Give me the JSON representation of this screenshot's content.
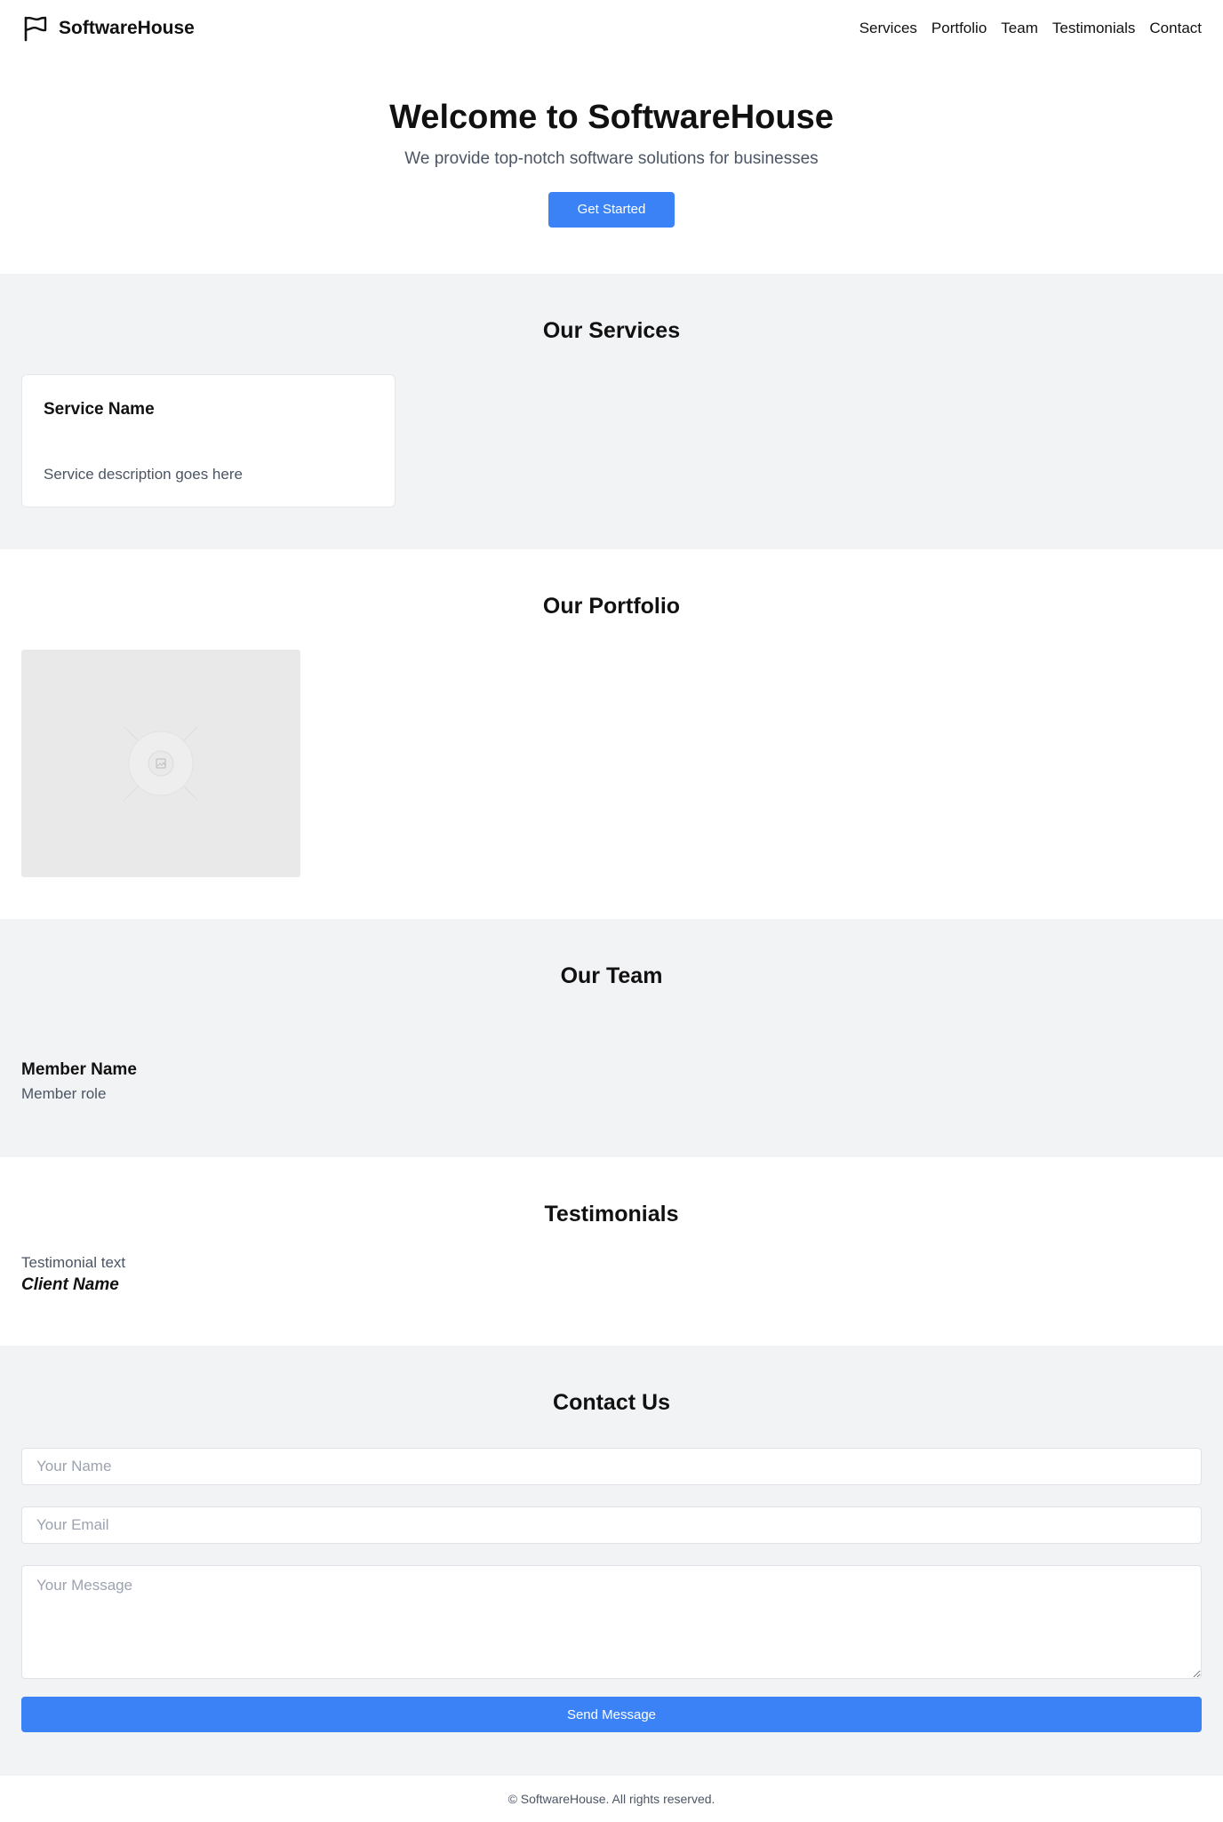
{
  "header": {
    "brand": "SoftwareHouse",
    "brand_icon": "flag-icon",
    "nav": [
      "Services",
      "Portfolio",
      "Team",
      "Testimonials",
      "Contact"
    ]
  },
  "hero": {
    "title": "Welcome to SoftwareHouse",
    "subtitle": "We provide top-notch software solutions for businesses",
    "cta": "Get Started"
  },
  "services": {
    "title": "Our Services",
    "items": [
      {
        "name": "Service Name",
        "description": "Service description goes here"
      }
    ]
  },
  "portfolio": {
    "title": "Our Portfolio",
    "items": [
      {
        "image_icon": "image-placeholder-icon"
      }
    ]
  },
  "team": {
    "title": "Our Team",
    "members": [
      {
        "name": "Member Name",
        "role": "Member role"
      }
    ]
  },
  "testimonials": {
    "title": "Testimonials",
    "items": [
      {
        "text": "Testimonial text",
        "client": "Client Name"
      }
    ]
  },
  "contact": {
    "title": "Contact Us",
    "name_placeholder": "Your Name",
    "email_placeholder": "Your Email",
    "message_placeholder": "Your Message",
    "submit": "Send Message"
  },
  "footer": {
    "text": "© SoftwareHouse. All rights reserved."
  },
  "colors": {
    "accent": "#3b82f6",
    "section_gray": "#f2f3f5",
    "muted_text": "#4b5563"
  }
}
